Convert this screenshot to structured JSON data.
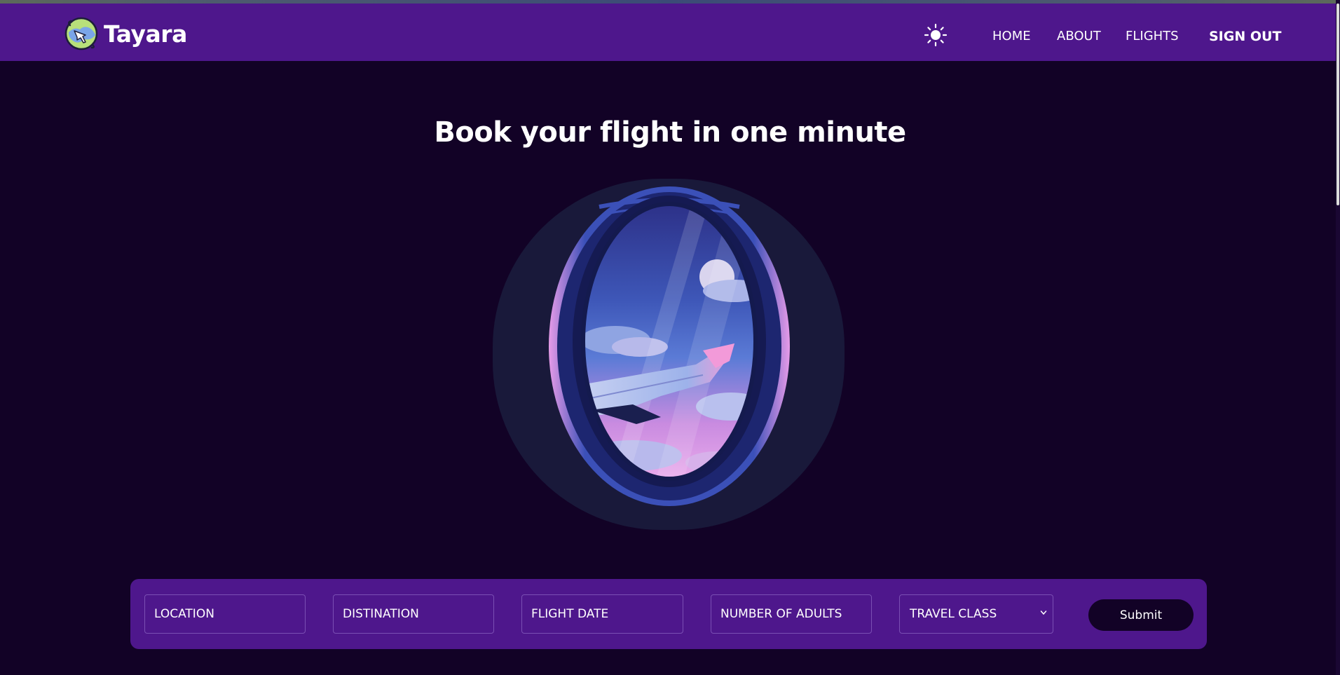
{
  "app": {
    "name": "Tayara"
  },
  "nav": {
    "links": [
      {
        "label": "HOME"
      },
      {
        "label": "ABOUT"
      },
      {
        "label": "FLIGHTS"
      }
    ],
    "sign_out": "SIGN OUT",
    "theme_icon": "sun-icon"
  },
  "hero": {
    "title": "Book your flight in one minute",
    "illustration": "airplane-window-illustration"
  },
  "search": {
    "location_placeholder": "LOCATION",
    "destination_placeholder": "DISTINATION",
    "date_placeholder": "FLIGHT DATE",
    "adults_placeholder": "NUMBER OF ADULTS",
    "travel_class": "TRAVEL CLASS",
    "submit_label": "Submit"
  },
  "colors": {
    "background": "#120226",
    "navbar": "#4e178c",
    "form": "#4e178c",
    "button": "#120226",
    "window_frame": "#19193a"
  }
}
